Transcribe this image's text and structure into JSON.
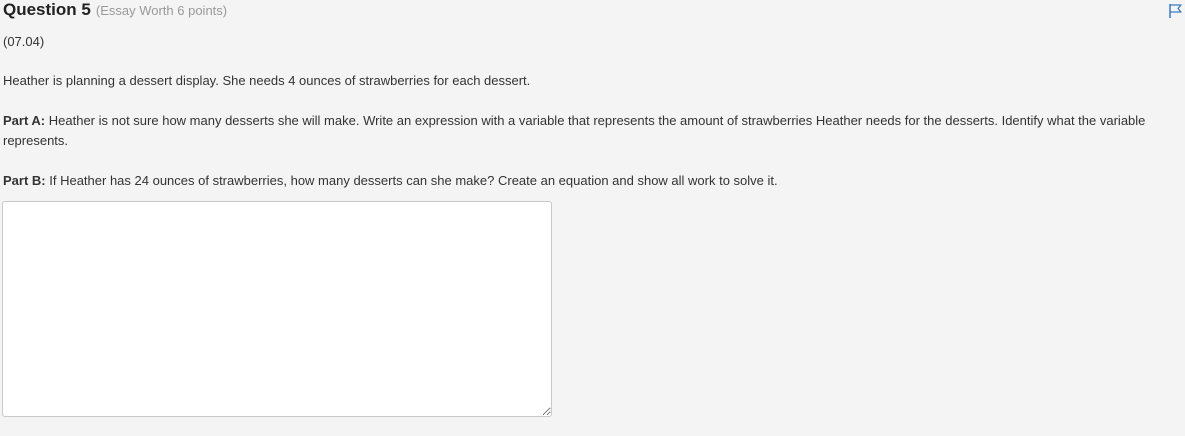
{
  "question": {
    "title": "Question 5",
    "worth": "(Essay Worth 6 points)",
    "code": "(07.04)",
    "intro": "Heather is planning a dessert display. She needs 4 ounces of strawberries for each dessert.",
    "part_a": {
      "label": "Part A:",
      "text": "Heather is not sure how many desserts she will make. Write an expression with a variable that represents the amount of strawberries Heather needs for the desserts. Identify what the variable represents."
    },
    "part_b": {
      "label": "Part B:",
      "text": "If Heather has 24 ounces of strawberries, how many desserts can she make? Create an equation and show all work to solve it."
    }
  },
  "answer": {
    "value": "",
    "placeholder": ""
  },
  "icons": {
    "flag": "flag-icon"
  },
  "colors": {
    "flag": "#3a7bbf",
    "background": "#f4f4f4",
    "muted_text": "#999999"
  }
}
